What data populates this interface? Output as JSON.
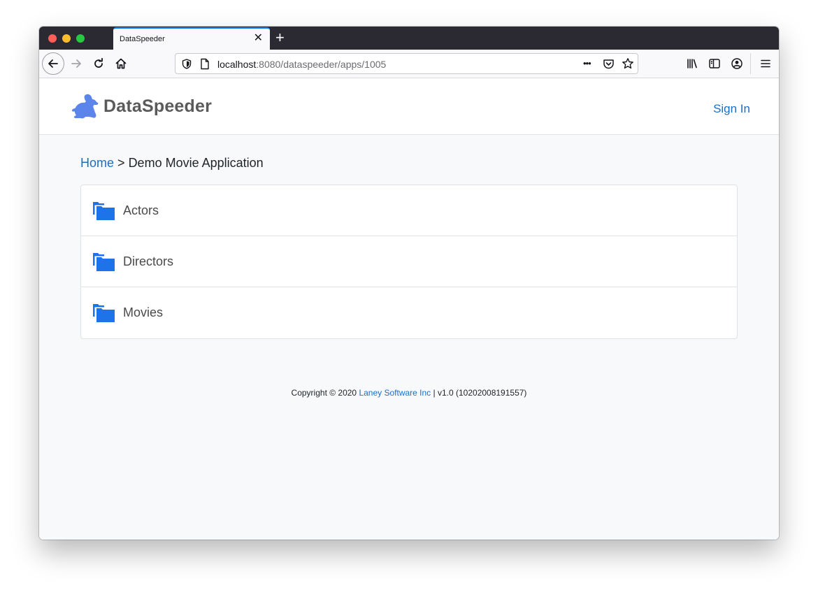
{
  "browser": {
    "tab_title": "DataSpeeder",
    "tab_close": "✕",
    "new_tab": "+",
    "url_host": "localhost",
    "url_rest": ":8080/dataspeeder/apps/1005",
    "page_actions": "•••"
  },
  "header": {
    "brand": "DataSpeeder",
    "sign_in": "Sign In"
  },
  "breadcrumb": {
    "home": "Home",
    "separator": ">",
    "current": "Demo Movie Application"
  },
  "folders": [
    {
      "label": "Actors"
    },
    {
      "label": "Directors"
    },
    {
      "label": "Movies"
    }
  ],
  "footer": {
    "prefix": "Copyright © 2020",
    "company": "Laney Software Inc",
    "suffix": "| v1.0 (10202008191557)"
  },
  "colors": {
    "accent": "#1b6ec2",
    "folder": "#1e73e8",
    "logo_rabbit": "#5b85ea"
  },
  "icons": [
    "back-arrow-icon",
    "forward-arrow-icon",
    "reload-icon",
    "home-icon",
    "shield-icon",
    "page-icon",
    "pocket-icon",
    "star-icon",
    "library-icon",
    "sidebar-icon",
    "account-icon",
    "menu-icon",
    "rabbit-logo-icon",
    "folder-icon"
  ]
}
